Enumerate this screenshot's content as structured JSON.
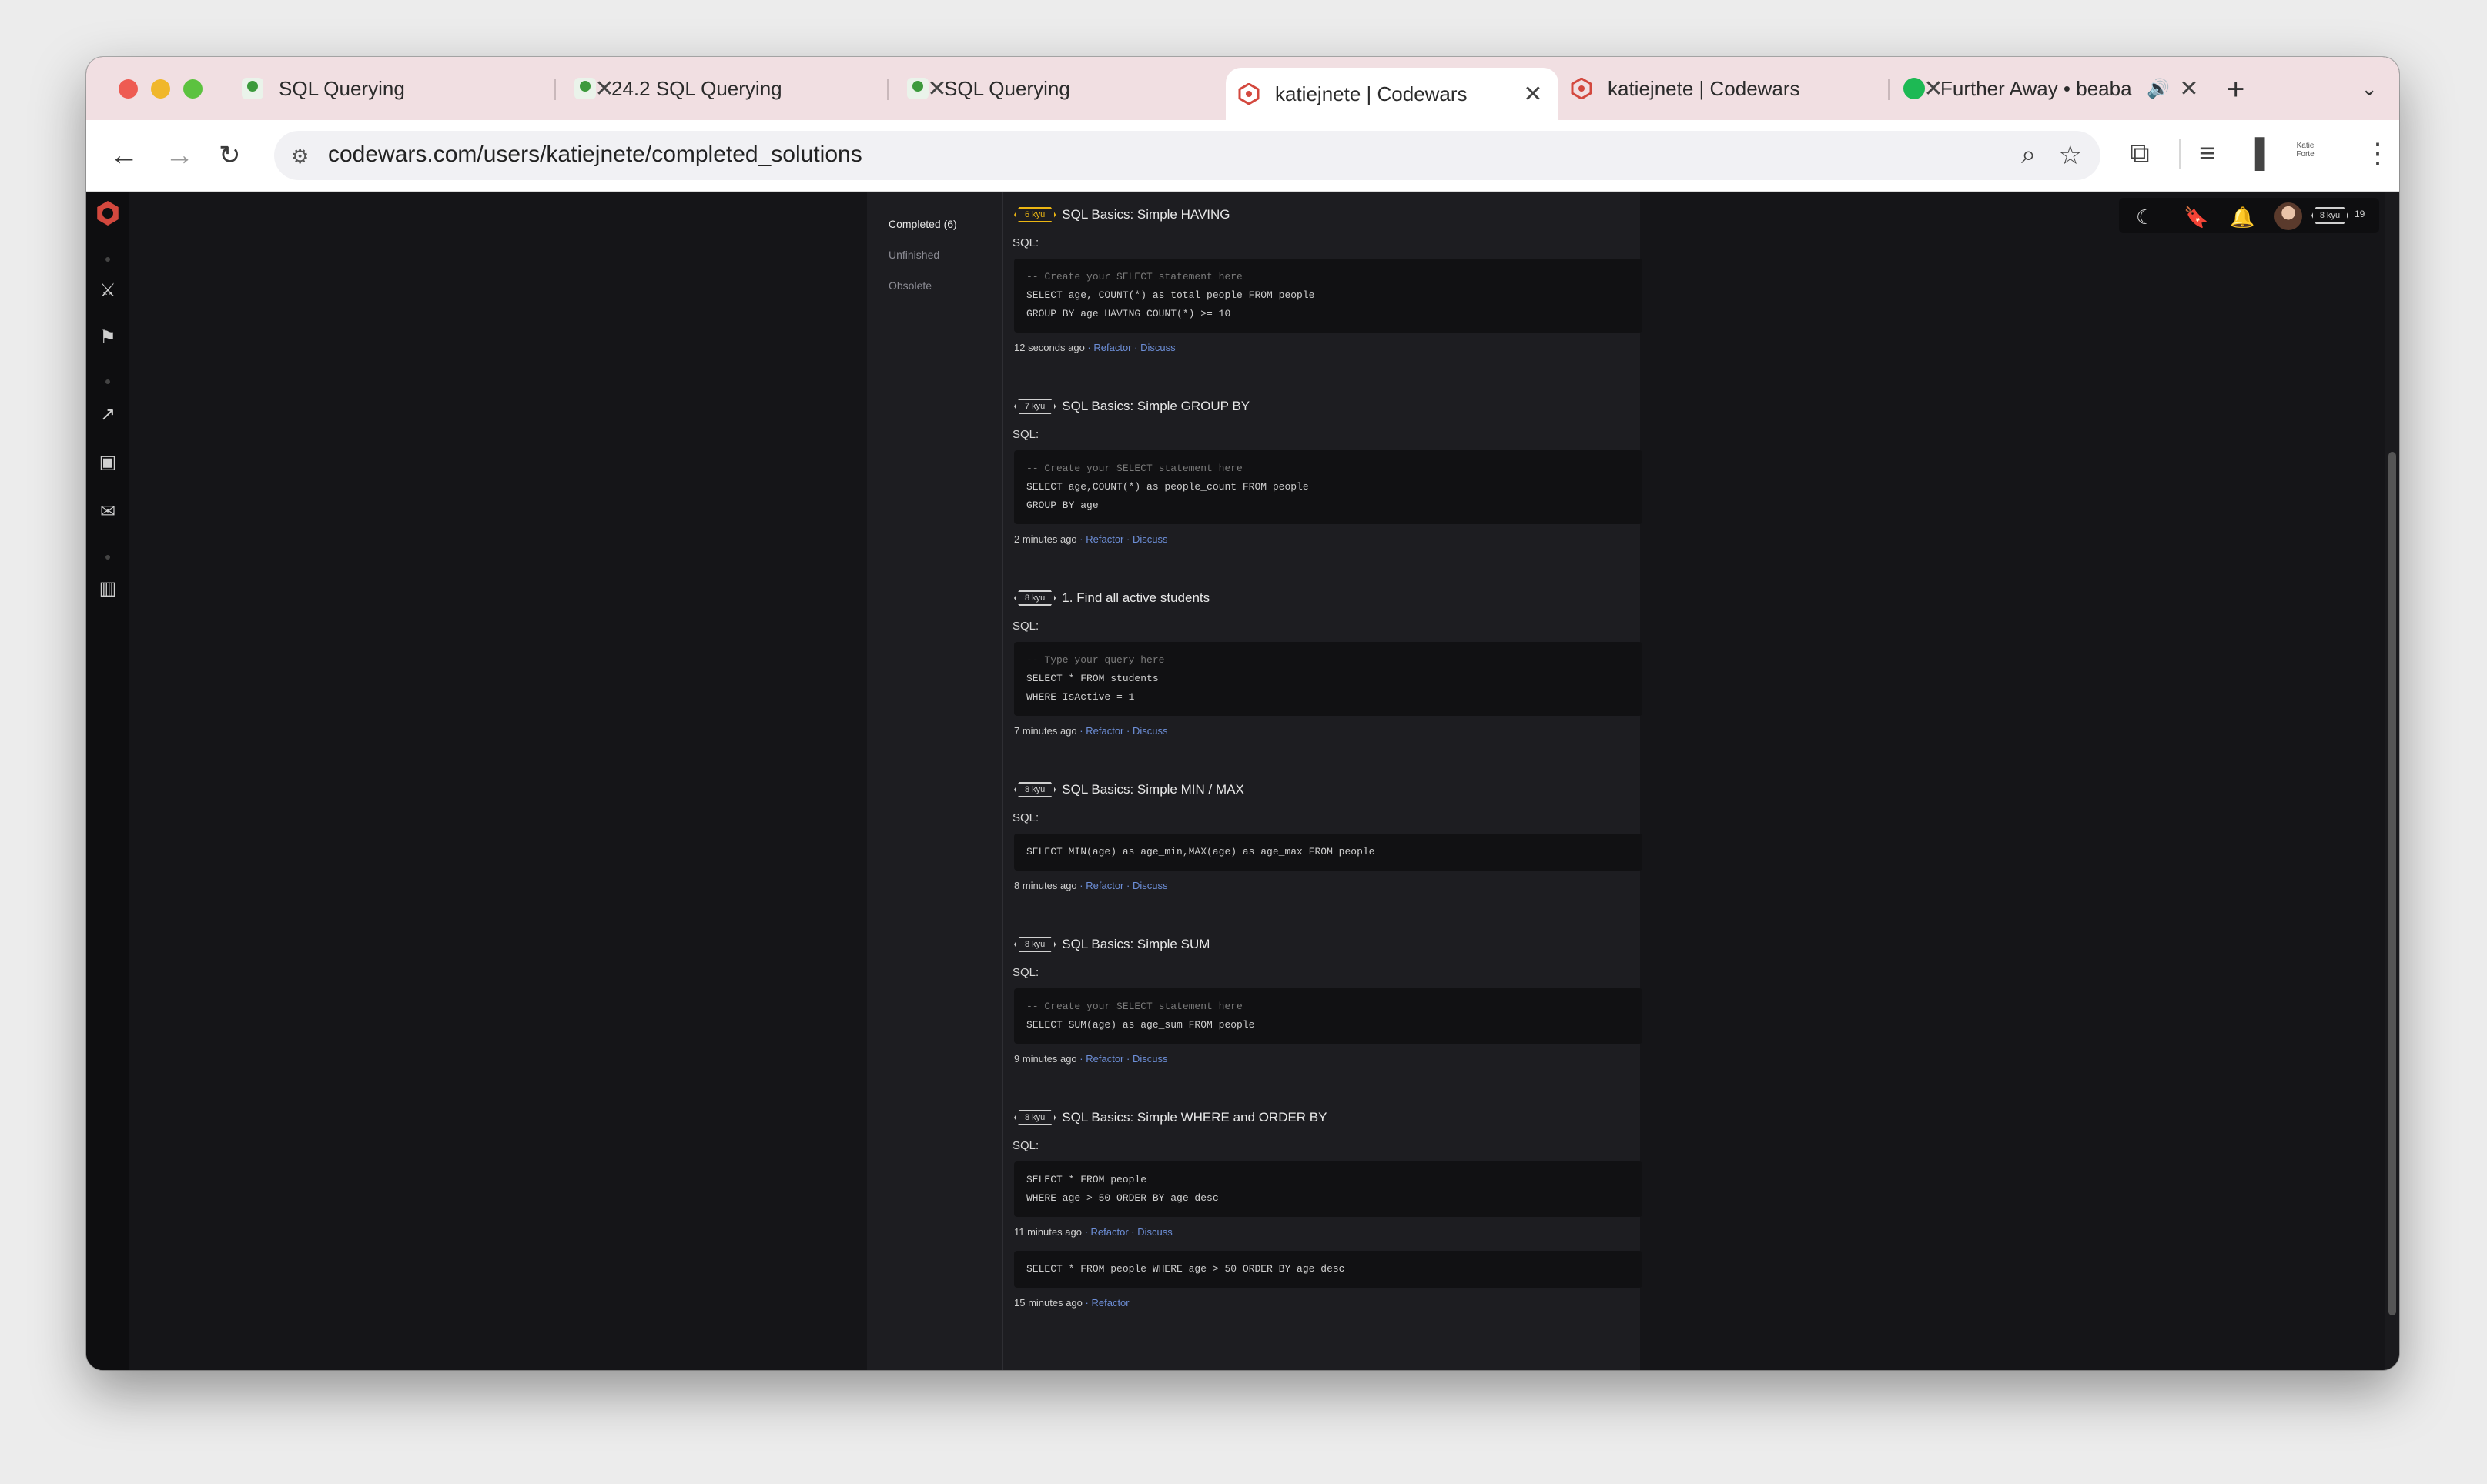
{
  "browser": {
    "tabs": [
      {
        "title": "SQL Querying",
        "icon": "green-person-icon"
      },
      {
        "title": "24.2 SQL Querying",
        "icon": "green-person-icon"
      },
      {
        "title": "SQL Querying",
        "icon": "green-person-icon"
      },
      {
        "title": "katiejnete | Codewars",
        "icon": "codewars-icon",
        "active": true
      },
      {
        "title": "katiejnete | Codewars",
        "icon": "codewars-icon"
      },
      {
        "title": "Further Away • beaba",
        "icon": "spotify-icon",
        "audio": true
      }
    ],
    "close_glyph": "✕",
    "new_tab_glyph": "+",
    "url": "codewars.com/users/katiejnete/completed_solutions",
    "profile_label": "Katie Forte"
  },
  "sidebar_nav": {
    "items": [
      "logo",
      "dojo-icon",
      "arena-icon",
      "leaderboard-icon",
      "kumite-icon",
      "discuss-icon",
      "docs-icon"
    ]
  },
  "solutions_nav": {
    "completed": "Completed (6)",
    "unfinished": "Unfinished",
    "obsolete": "Obsolete"
  },
  "user_bar": {
    "rank": "8 kyu",
    "honor": "19"
  },
  "colors": {
    "accent_link": "#6d8fd8",
    "rank_yellow": "#ecb613",
    "background": "#151518"
  },
  "solutions": [
    {
      "rank": "6 kyu",
      "title": "SQL Basics: Simple HAVING",
      "language": "SQL:",
      "code": [
        "-- Create your SELECT statement here",
        "SELECT age, COUNT(*) as total_people FROM people",
        "GROUP BY age HAVING COUNT(*) >= 10"
      ],
      "time": "12 seconds ago",
      "actions": [
        "Refactor",
        "Discuss"
      ]
    },
    {
      "rank": "7 kyu",
      "title": "SQL Basics: Simple GROUP BY",
      "language": "SQL:",
      "code": [
        "-- Create your SELECT statement here",
        "SELECT age,COUNT(*) as people_count FROM people",
        "GROUP BY age"
      ],
      "time": "2 minutes ago",
      "actions": [
        "Refactor",
        "Discuss"
      ]
    },
    {
      "rank": "8 kyu",
      "title": "1. Find all active students",
      "language": "SQL:",
      "code": [
        "-- Type your query here",
        "SELECT * FROM students",
        "WHERE IsActive = 1"
      ],
      "time": "7 minutes ago",
      "actions": [
        "Refactor",
        "Discuss"
      ]
    },
    {
      "rank": "8 kyu",
      "title": "SQL Basics: Simple MIN / MAX",
      "language": "SQL:",
      "code": [
        "SELECT MIN(age) as age_min,MAX(age) as age_max FROM people"
      ],
      "time": "8 minutes ago",
      "actions": [
        "Refactor",
        "Discuss"
      ]
    },
    {
      "rank": "8 kyu",
      "title": "SQL Basics: Simple SUM",
      "language": "SQL:",
      "code": [
        "-- Create your SELECT statement here",
        "SELECT SUM(age) as age_sum FROM people"
      ],
      "time": "9 minutes ago",
      "actions": [
        "Refactor",
        "Discuss"
      ]
    },
    {
      "rank": "8 kyu",
      "title": "SQL Basics: Simple WHERE and ORDER BY",
      "language": "SQL:",
      "code": [
        "SELECT * FROM people",
        "WHERE age > 50 ORDER BY age desc"
      ],
      "time": "11 minutes ago",
      "actions": [
        "Refactor",
        "Discuss"
      ]
    }
  ],
  "extra_solution": {
    "code": [
      "SELECT * FROM people WHERE age > 50 ORDER BY age desc"
    ],
    "time": "15 minutes ago",
    "actions": [
      "Refactor"
    ]
  }
}
